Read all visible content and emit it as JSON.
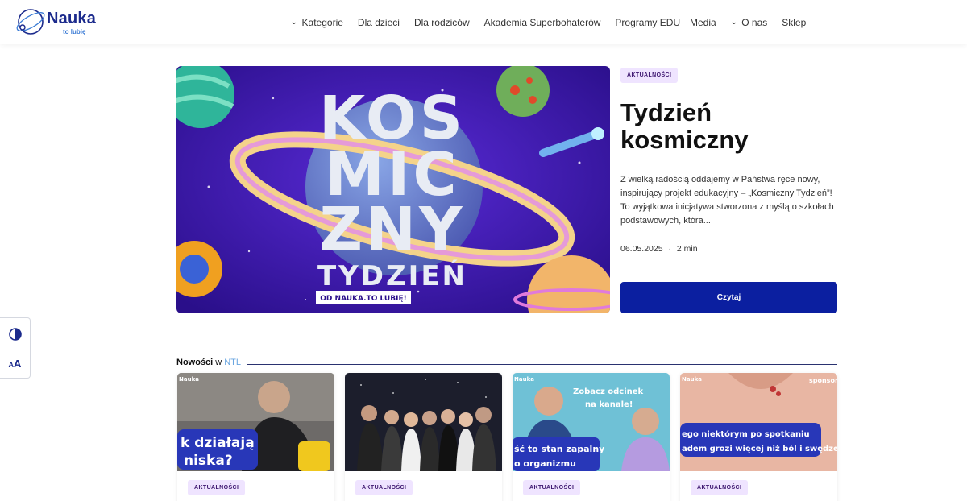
{
  "logo": {
    "word": "Nauka",
    "tagline": "to lubię"
  },
  "nav": {
    "main": [
      {
        "label": "Kategorie",
        "dropdown": true
      },
      {
        "label": "Dla dzieci",
        "dropdown": false
      },
      {
        "label": "Dla rodziców",
        "dropdown": false
      },
      {
        "label": "Akademia Superbohaterów",
        "dropdown": false
      },
      {
        "label": "Programy EDU",
        "dropdown": false
      }
    ],
    "right": [
      {
        "label": "Media",
        "dropdown": false
      },
      {
        "label": "O nas",
        "dropdown": true
      },
      {
        "label": "Sklep",
        "dropdown": false
      }
    ]
  },
  "a11y": {
    "font_label_big": "A",
    "font_label_small": "A"
  },
  "hero": {
    "badge": "AKTUALNOŚCI",
    "title_line1": "Tydzień",
    "title_line2": "kosmiczny",
    "description": "Z wielką radością oddajemy w Państwa ręce nowy, inspirujący projekt edukacyjny – „Kosmiczny Tydzień”! To wyjątkowa inicjatywa stworzona z myślą o szkołach podstawowych, która...",
    "date": "06.05.2025",
    "read_time": "2 min",
    "button": "Czytaj",
    "image": {
      "line1": "KOS",
      "line2": "MIC",
      "line3": "ZNY",
      "line4": "TYDZIEŃ",
      "line5": "OD NAUKA.TO LUBIĘ!"
    }
  },
  "news": {
    "heading_bold": "Nowości",
    "heading_w": "w",
    "heading_accent": "NTL",
    "cards": [
      {
        "badge": "AKTUALNOŚCI",
        "thumb_text1": "k działają",
        "thumb_text2": "niska?",
        "corner": "Nauka"
      },
      {
        "badge": "AKTUALNOŚCI"
      },
      {
        "badge": "AKTUALNOŚCI",
        "thumb_text0": "Zobacz odcinek",
        "thumb_text0b": "na kanale!",
        "thumb_text1": "ść to stan zapalny",
        "thumb_text2": "o organizmu",
        "corner": "Nauka"
      },
      {
        "badge": "AKTUALNOŚCI",
        "thumb_text1": "ego niektórym po spotkaniu",
        "thumb_text2": "adem grozi więcej niż ból i swędzenie?",
        "corner": "Nauka",
        "corner_right": "sponsor"
      }
    ]
  },
  "colors": {
    "brand": "#1b2a8c",
    "button": "#0b1fa0",
    "badge_bg": "#efe4ff",
    "accent": "#6aa6e0"
  }
}
